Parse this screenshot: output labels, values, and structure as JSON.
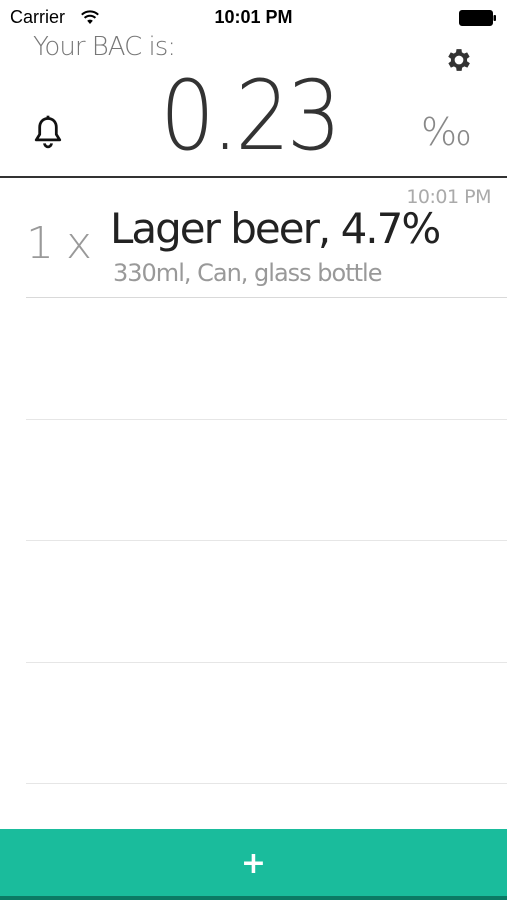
{
  "status_bar": {
    "carrier": "Carrier",
    "time": "10:01 PM"
  },
  "header": {
    "label": "Your BAC is:",
    "value": "0.23",
    "unit": "‰"
  },
  "drinks": [
    {
      "time": "10:01 PM",
      "quantity": "1 x",
      "name": "Lager beer, 4.7%",
      "detail": "330ml, Can, glass bottle"
    }
  ],
  "add_button": {
    "label": "+"
  },
  "colors": {
    "accent": "#1abc9c",
    "divider": "#333333"
  },
  "icons": {
    "settings": "gear-icon",
    "alarm": "bell-icon",
    "add": "plus-icon",
    "wifi": "wifi-icon",
    "battery": "battery-icon"
  }
}
